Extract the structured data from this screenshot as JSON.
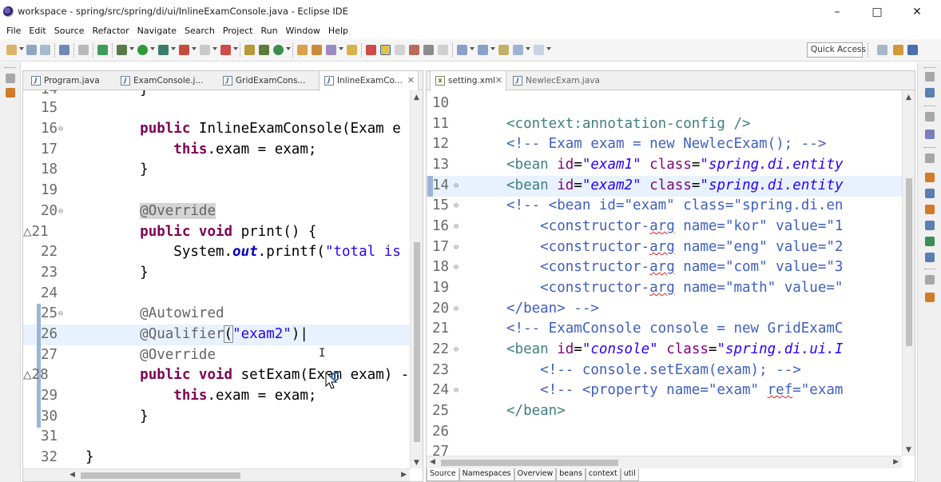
{
  "window": {
    "title": "workspace - spring/src/spring/di/ui/InlineExamConsole.java - Eclipse IDE",
    "controls": [
      "–",
      "□",
      "✕"
    ]
  },
  "menu": [
    "File",
    "Edit",
    "Source",
    "Refactor",
    "Navigate",
    "Search",
    "Project",
    "Run",
    "Window",
    "Help"
  ],
  "toolbar": {
    "quick_access": "Quick Access"
  },
  "left_editor": {
    "tabs": [
      {
        "label": "Program.java",
        "icon": "java-file-icon"
      },
      {
        "label": "ExamConsole.j...",
        "icon": "java-file-icon"
      },
      {
        "label": "GridExamCons...",
        "icon": "java-file-icon"
      },
      {
        "label": "InlineExamCo...",
        "icon": "java-file-icon",
        "close": "✕"
      }
    ],
    "active_tab": 3
  },
  "right_editor": {
    "tabs": [
      {
        "label": "setting.xml",
        "icon": "xml-file-icon",
        "close": "✕"
      },
      {
        "label": "NewlecExam.java",
        "icon": "java-file-icon"
      }
    ],
    "active_tab": 0,
    "subtabs": [
      "Source",
      "Namespaces",
      "Overview",
      "beans",
      "context",
      "util"
    ],
    "active_subtab": 0
  }
}
